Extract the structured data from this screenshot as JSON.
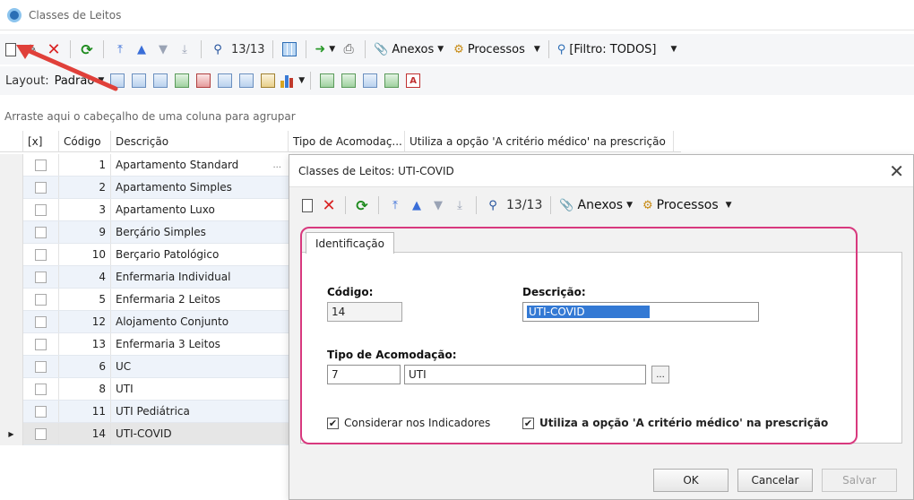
{
  "window": {
    "title": "Classes de Leitos"
  },
  "toolbar": {
    "record_counter": "13/13",
    "attachments_label": "Anexos",
    "processes_label": "Processos",
    "filter_label": "[Filtro: TODOS]"
  },
  "layout_bar": {
    "layout_label": "Layout:",
    "preset_label": "Padrão"
  },
  "grid": {
    "group_hint": "Arraste aqui o cabeçalho de uma coluna para agrupar",
    "columns": [
      "[x]",
      "Código",
      "Descrição",
      "Tipo de Acomodaç...",
      "Utiliza a opção 'A critério médico' na prescrição"
    ],
    "rows": [
      {
        "code": "1",
        "description": "Apartamento Standard"
      },
      {
        "code": "2",
        "description": "Apartamento Simples"
      },
      {
        "code": "3",
        "description": "Apartamento Luxo"
      },
      {
        "code": "9",
        "description": "Berçário Simples"
      },
      {
        "code": "10",
        "description": "Berçario Patológico"
      },
      {
        "code": "4",
        "description": "Enfermaria Individual"
      },
      {
        "code": "5",
        "description": "Enfermaria 2 Leitos"
      },
      {
        "code": "12",
        "description": "Alojamento Conjunto"
      },
      {
        "code": "13",
        "description": "Enfermaria 3 Leitos"
      },
      {
        "code": "6",
        "description": "UC"
      },
      {
        "code": "8",
        "description": "UTI"
      },
      {
        "code": "11",
        "description": "UTI Pediátrica"
      },
      {
        "code": "14",
        "description": "UTI-COVID"
      }
    ],
    "ellipsis": "..."
  },
  "dialog": {
    "title": "Classes de Leitos: UTI-COVID",
    "record_counter": "13/13",
    "attachments_label": "Anexos",
    "processes_label": "Processos",
    "tab_label": "Identificação",
    "code_label": "Código:",
    "code_value": "14",
    "description_label": "Descrição:",
    "description_value": "UTI-COVID",
    "type_label": "Tipo de Acomodação:",
    "type_code": "7",
    "type_name": "UTI",
    "lookup_button": "...",
    "consider_indicators_label": "Considerar nos Indicadores",
    "use_medical_criteria_label": "Utiliza a opção 'A critério médico' na prescrição",
    "ok_label": "OK",
    "cancel_label": "Cancelar",
    "save_label": "Salvar"
  },
  "colors": {
    "highlight_frame": "#d8397e",
    "arrow": "#e0403a",
    "selection": "#3379d4"
  }
}
